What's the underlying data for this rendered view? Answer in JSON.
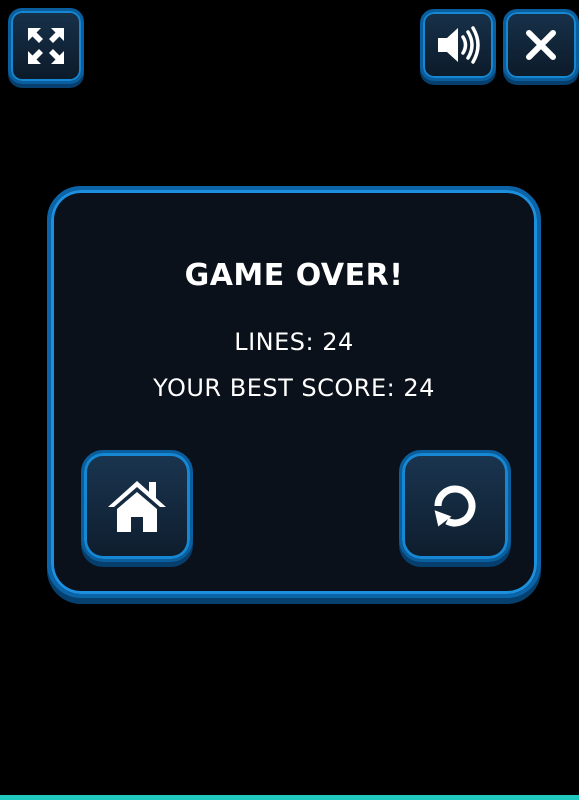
{
  "top_bar": {
    "fullscreen_icon": "fullscreen-icon",
    "sound_icon": "speaker-icon",
    "close_icon": "close-icon"
  },
  "game_over_panel": {
    "title": "GAME OVER!",
    "lines_text": "LINES: 24",
    "best_score_text": "YOUR BEST SCORE: 24",
    "home_icon": "home-icon",
    "restart_icon": "restart-icon"
  },
  "colors": {
    "background": "#000000",
    "accent_blue": "#1687d3",
    "panel_fill": "#0b111a",
    "text": "#ffffff",
    "bottom_bar": "#1fc9c0"
  }
}
